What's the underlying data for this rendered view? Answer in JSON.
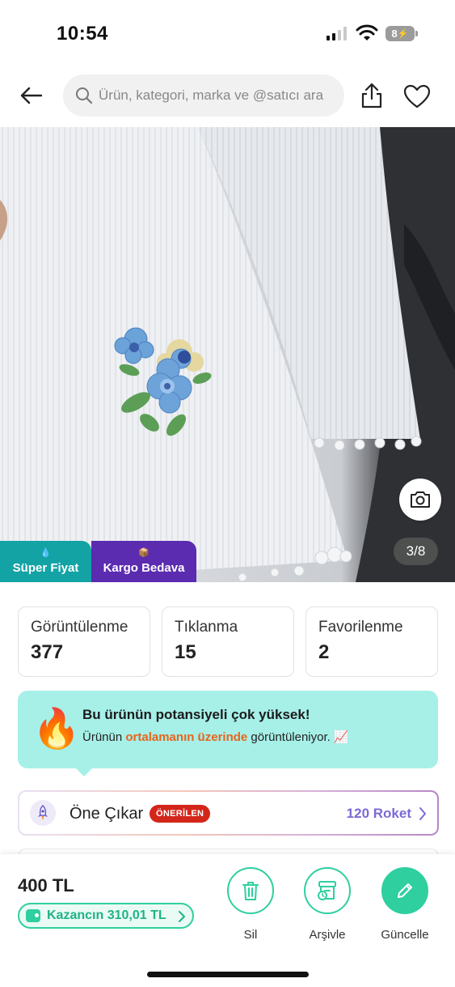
{
  "status_bar": {
    "time": "10:54",
    "battery": "8"
  },
  "header": {
    "search_placeholder": "Ürün, kategori, marka ve @satıcı ara"
  },
  "gallery": {
    "counter": "3/8",
    "badges": [
      {
        "icon": "💧",
        "label": "Süper Fiyat",
        "color": "#13a3a5"
      },
      {
        "icon": "📦",
        "label": "Kargo Bedava",
        "color": "#5b2bb0"
      }
    ]
  },
  "stats": [
    {
      "label": "Görüntülenme",
      "value": "377"
    },
    {
      "label": "Tıklanma",
      "value": "15"
    },
    {
      "label": "Favorilenme",
      "value": "2"
    }
  ],
  "potential": {
    "title": "Bu ürünün potansiyeli çok yüksek!",
    "text_before": "Ürünün ",
    "text_highlight": "ortalamanın üzerinde",
    "text_after": " görüntüleniyor.",
    "icon": "🔥",
    "chart_icon": "📈"
  },
  "boost": {
    "label": "Öne Çıkar",
    "badge": "ÖNERİLEN",
    "cost": "120 Roket"
  },
  "bottom_bar": {
    "price": "400 TL",
    "earning": "Kazancın 310,01 TL",
    "actions": [
      {
        "label": "Sil",
        "icon": "trash-icon"
      },
      {
        "label": "Arşivle",
        "icon": "archive-icon"
      },
      {
        "label": "Güncelle",
        "icon": "pencil-icon"
      }
    ]
  },
  "colors": {
    "accent_green": "#2fcfa0",
    "teal_banner": "#a6f0e8",
    "highlight_orange": "#e8641b",
    "recommended_red": "#d3261a",
    "roket_purple": "#7b6ad6"
  }
}
